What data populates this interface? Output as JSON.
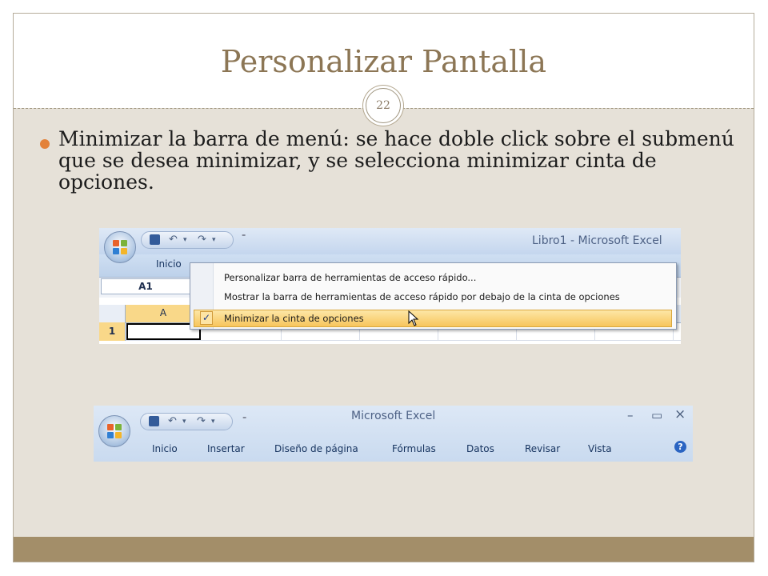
{
  "slide": {
    "title": "Personalizar Pantalla",
    "number": "22",
    "bullet": "Minimizar la barra de menú: se hace doble click sobre el submenú que se desea minimizar, y se selecciona minimizar cinta de opciones."
  },
  "excel_before": {
    "window_title": "Libro1 - Microsoft Excel",
    "tab_home": "Inicio",
    "name_box": "A1",
    "column_a": "A",
    "row_1": "1",
    "undo_glyph": "↶",
    "redo_glyph": "↷",
    "dropdown_glyph": "▾",
    "customize_glyph": "⁼",
    "cursor_icon": "arrow-cursor-icon",
    "context_menu": [
      {
        "label": "Personalizar barra de herramientas de acceso rápido..."
      },
      {
        "label": "Mostrar la barra de herramientas de acceso rápido por debajo de la cinta de opciones"
      },
      {
        "label": "Minimizar la cinta de opciones",
        "checked": true,
        "check_glyph": "✓"
      }
    ]
  },
  "excel_after": {
    "window_title": "Microsoft Excel",
    "minimize_glyph": "–",
    "maximize_glyph": "▭",
    "close_glyph": "×",
    "help_glyph": "?",
    "tabs": [
      "Inicio",
      "Insertar",
      "Diseño de página",
      "Fórmulas",
      "Datos",
      "Revisar",
      "Vista"
    ]
  },
  "colors": {
    "title": "#8c7655",
    "bullet": "#e3823a",
    "bottom_bar": "#a38e69",
    "slide_bg": "#e6e1d8",
    "highlight": "#f7c55c"
  }
}
